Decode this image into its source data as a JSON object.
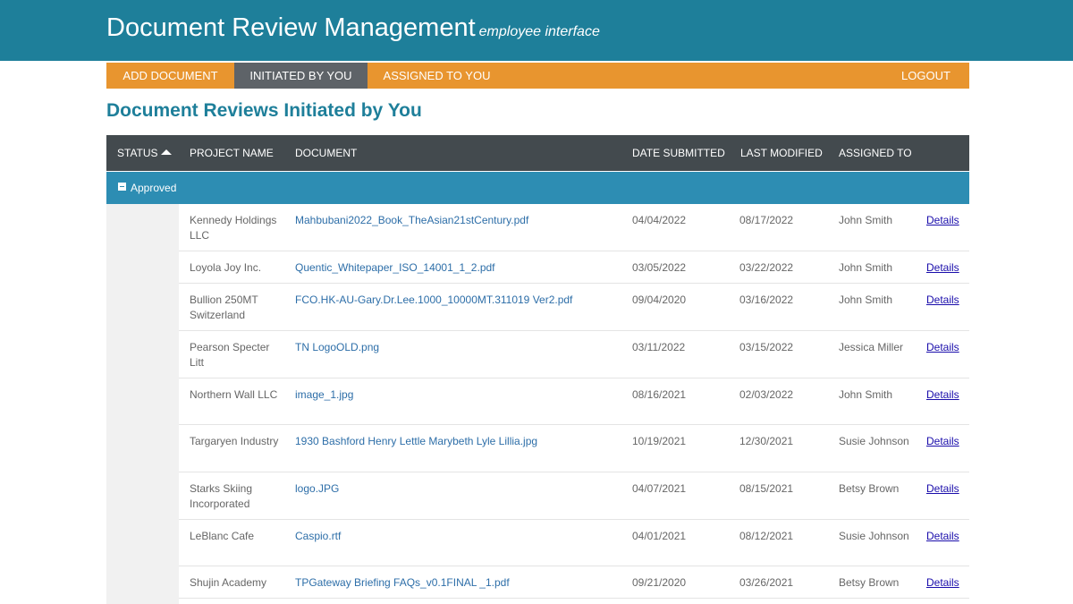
{
  "header": {
    "title": "Document Review Management",
    "subtitle": "employee interface"
  },
  "nav": {
    "items": [
      {
        "label": "ADD DOCUMENT",
        "active": false
      },
      {
        "label": "INITIATED BY YOU",
        "active": true
      },
      {
        "label": "ASSIGNED TO YOU",
        "active": false
      }
    ],
    "logout": "LOGOUT"
  },
  "page": {
    "heading": "Document Reviews Initiated by You"
  },
  "table": {
    "columns": {
      "status": "STATUS",
      "project": "PROJECT NAME",
      "document": "DOCUMENT",
      "date_submitted": "DATE SUBMITTED",
      "last_modified": "LAST MODIFIED",
      "assigned_to": "ASSIGNED TO"
    },
    "sort_icon": "sort-ascending-icon",
    "group": {
      "label": "Approved",
      "icon": "collapse-minus-icon"
    },
    "rows": [
      {
        "project": "Kennedy Holdings LLC",
        "document": "Mahbubani2022_Book_TheAsian21stCentury.pdf",
        "date_submitted": "04/04/2022",
        "last_modified": "08/17/2022",
        "assigned_to": "John Smith",
        "details": "Details"
      },
      {
        "project": "Loyola Joy Inc.",
        "document": "Quentic_Whitepaper_ISO_14001_1_2.pdf",
        "date_submitted": "03/05/2022",
        "last_modified": "03/22/2022",
        "assigned_to": "John Smith",
        "details": "Details"
      },
      {
        "project": "Bullion 250MT Switzerland",
        "document": "FCO.HK-AU-Gary.Dr.Lee.1000_10000MT.311019 Ver2.pdf",
        "date_submitted": "09/04/2020",
        "last_modified": "03/16/2022",
        "assigned_to": "John Smith",
        "details": "Details"
      },
      {
        "project": "Pearson Specter Litt",
        "document": "TN LogoOLD.png",
        "date_submitted": "03/11/2022",
        "last_modified": "03/15/2022",
        "assigned_to": "Jessica Miller",
        "details": "Details"
      },
      {
        "project": "Northern Wall LLC",
        "document": "image_1.jpg",
        "date_submitted": "08/16/2021",
        "last_modified": "02/03/2022",
        "assigned_to": "John Smith",
        "details": "Details"
      },
      {
        "project": "Targaryen Industry",
        "document": "1930 Bashford Henry Lettle Marybeth Lyle Lillia.jpg",
        "date_submitted": "10/19/2021",
        "last_modified": "12/30/2021",
        "assigned_to": "Susie Johnson",
        "details": "Details"
      },
      {
        "project": "Starks Skiing Incorporated",
        "document": "logo.JPG",
        "date_submitted": "04/07/2021",
        "last_modified": "08/15/2021",
        "assigned_to": "Betsy Brown",
        "details": "Details"
      },
      {
        "project": "LeBlanc Cafe",
        "document": "Caspio.rtf",
        "date_submitted": "04/01/2021",
        "last_modified": "08/12/2021",
        "assigned_to": "Susie Johnson",
        "details": "Details"
      },
      {
        "project": "Shujin Academy",
        "document": "TPGateway Briefing FAQs_v0.1FINAL _1.pdf",
        "date_submitted": "09/21/2020",
        "last_modified": "03/26/2021",
        "assigned_to": "Betsy Brown",
        "details": "Details"
      }
    ]
  }
}
